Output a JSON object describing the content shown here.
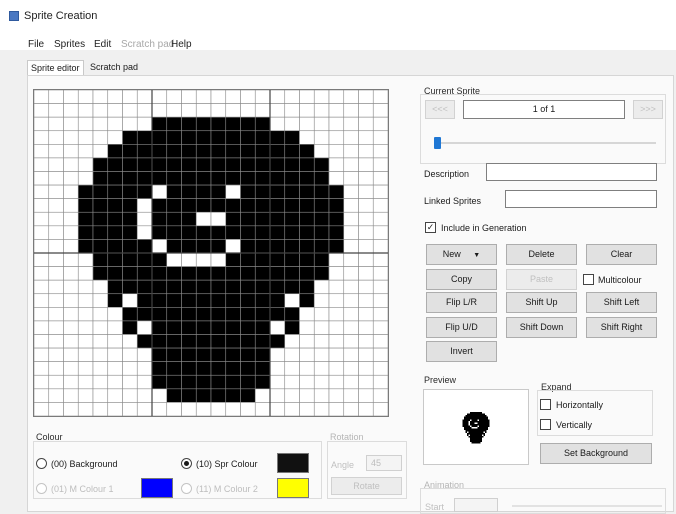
{
  "window": {
    "title": "Sprite Creation"
  },
  "menu": {
    "file": "File",
    "sprites": "Sprites",
    "edit": "Edit",
    "scratch_pad": "Scratch pad",
    "help": "Help"
  },
  "tabs": {
    "sprite_editor": "Sprite editor",
    "scratch_pad": "Scratch pad"
  },
  "grid": {
    "rows": 24,
    "cols": 24,
    "bitmap": [
      "000000000000000000000000",
      "000000000000000000000000",
      "000000001111111100000000",
      "000000111111111111000000",
      "000001111111111111100000",
      "000011111111111111110000",
      "000011111111111111110000",
      "000111110111101111111000",
      "000111101111111111111000",
      "000111101110011111111000",
      "000111101111111111111000",
      "000111110111101111111000",
      "000011111000011111110000",
      "000011111111111111110000",
      "000001111111111111100000",
      "000001011111111110100000",
      "000000111111111111000000",
      "000000101111111101000000",
      "000000011111111110000000",
      "000000001111111100000000",
      "000000001111111100000000",
      "000000001111111100000000",
      "000000000111111000000000",
      "000000000000000000000000"
    ]
  },
  "colour": {
    "label": "Colour",
    "background": "(00) Background",
    "mc1": "(01) M Colour 1",
    "spr": "(10) Spr Colour",
    "mc2": "(11) M Colour 2",
    "selected": "spr",
    "mc1_color": "#0000ff",
    "spr_color": "#111111",
    "mc2_color": "#ffff00"
  },
  "rotation": {
    "label": "Rotation",
    "angle_label": "Angle",
    "angle_value": "45",
    "rotate": "Rotate"
  },
  "current": {
    "label": "Current Sprite",
    "prev": "<<<",
    "next": ">>>",
    "counter": "1 of 1",
    "slider_value": 0
  },
  "description": {
    "label": "Description",
    "value": ""
  },
  "linked": {
    "label": "Linked Sprites",
    "value": ""
  },
  "include": {
    "label": "Include in Generation",
    "checked": true
  },
  "buttons": {
    "new": "New",
    "delete": "Delete",
    "clear": "Clear",
    "copy": "Copy",
    "paste": "Paste",
    "multicolour": "Multicolour",
    "flip_lr": "Flip L/R",
    "shift_up": "Shift Up",
    "shift_left": "Shift Left",
    "flip_ud": "Flip U/D",
    "shift_down": "Shift Down",
    "shift_right": "Shift Right",
    "invert": "Invert"
  },
  "preview": {
    "label": "Preview"
  },
  "expand": {
    "label": "Expand",
    "horizontally": "Horizontally",
    "vertically": "Vertically",
    "set_background": "Set Background"
  },
  "animation": {
    "label": "Animation",
    "start_label": "Start"
  }
}
